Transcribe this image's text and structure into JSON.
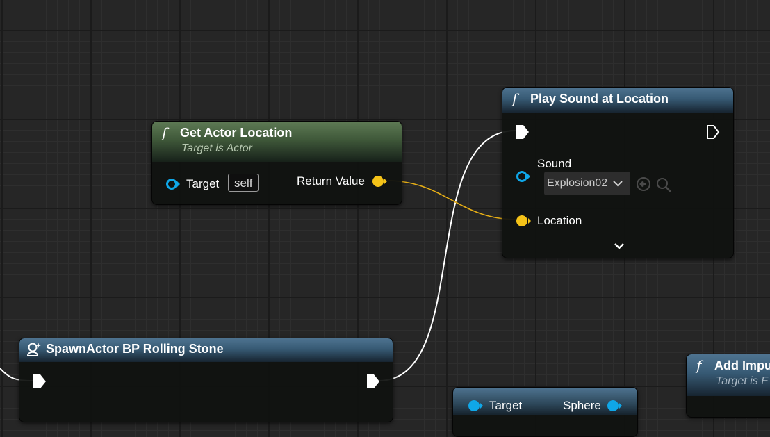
{
  "nodes": {
    "get_actor_location": {
      "title": "Get Actor Location",
      "subtitle": "Target is Actor",
      "target_label": "Target",
      "target_value": "self",
      "return_label": "Return Value"
    },
    "play_sound": {
      "title": "Play Sound at Location",
      "sound_label": "Sound",
      "sound_value": "Explosion02",
      "location_label": "Location"
    },
    "spawn_actor": {
      "title": "SpawnActor BP Rolling Stone"
    },
    "add_impulse": {
      "title": "Add Impu",
      "subtitle": "Target is F"
    },
    "bottom_node": {
      "target_label": "Target",
      "sphere_label": "Sphere"
    }
  },
  "icons": {
    "function": "f",
    "expand": "chevron-down-icon",
    "use_asset": "arrow-left-circle-icon",
    "browse": "search-icon",
    "spawn": "spawn-actor-icon"
  },
  "colors": {
    "exec_wire": "#ffffff",
    "vector_pin": "#f5c318",
    "object_pin": "#0fa7e8",
    "header_green": "#4e6a47",
    "header_blue": "#3f6380"
  }
}
